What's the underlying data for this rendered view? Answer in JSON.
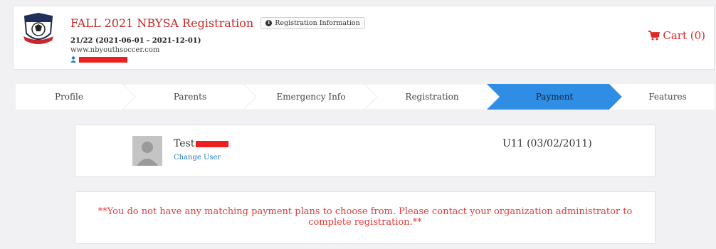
{
  "header": {
    "event_title": "FALL 2021 NBYSA Registration",
    "info_button": "Registration Information",
    "season": "21/22 (2021-06-01 - 2021-12-01)",
    "website": "www.nbyouthsoccer.com",
    "cart_label": "Cart (0)"
  },
  "steps": [
    "Profile",
    "Parents",
    "Emergency Info",
    "Registration",
    "Payment",
    "Features"
  ],
  "active_step": "Payment",
  "player": {
    "first_name": "Test",
    "change_user": "Change User",
    "age_group": "U11 (03/02/2011)"
  },
  "message": "**You do not have any matching payment plans to choose from. Please contact your organization administrator to complete registration.**",
  "colors": {
    "accent_red": "#c72727",
    "active_step": "#2f8de4",
    "link": "#2a7ac2"
  }
}
